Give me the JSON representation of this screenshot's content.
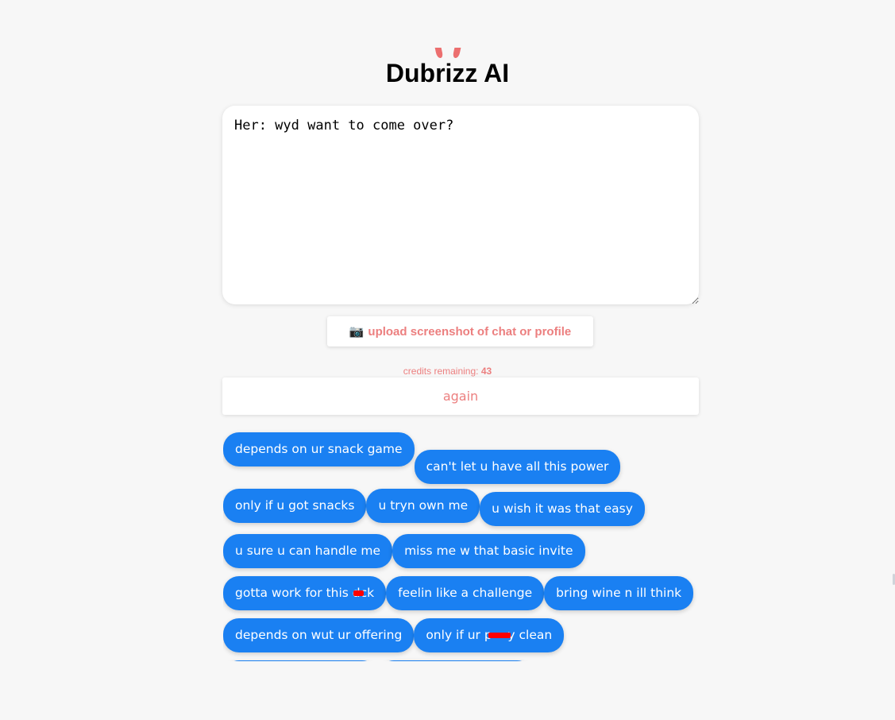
{
  "header": {
    "title": "Dubrizz AI",
    "logo_icon": "devil-horns-icon"
  },
  "chat_input": {
    "value": "Her: wyd want to come over?"
  },
  "upload": {
    "icon": "camera-icon",
    "icon_glyph": "📷",
    "label": "upload screenshot of chat or profile"
  },
  "credits": {
    "label": "credits remaining:",
    "count": "43"
  },
  "again_button": {
    "label": "again"
  },
  "replies": [
    "depends on ur snack game",
    "can't let u have all this power",
    "only if u got snacks",
    "u tryn own me",
    "u wish it was that easy",
    "u sure u can handle me",
    "miss me w that basic invite",
    "gotta work for this d",
    "ck",
    "feelin like a challenge",
    "bring wine n ill think",
    "depends on wut ur offering",
    "only if ur p",
    "y clean"
  ],
  "colors": {
    "accent": "#ec7f7f",
    "bubble": "#1a80f2",
    "censor": "#ff0000",
    "background": "#f7f7f7"
  }
}
